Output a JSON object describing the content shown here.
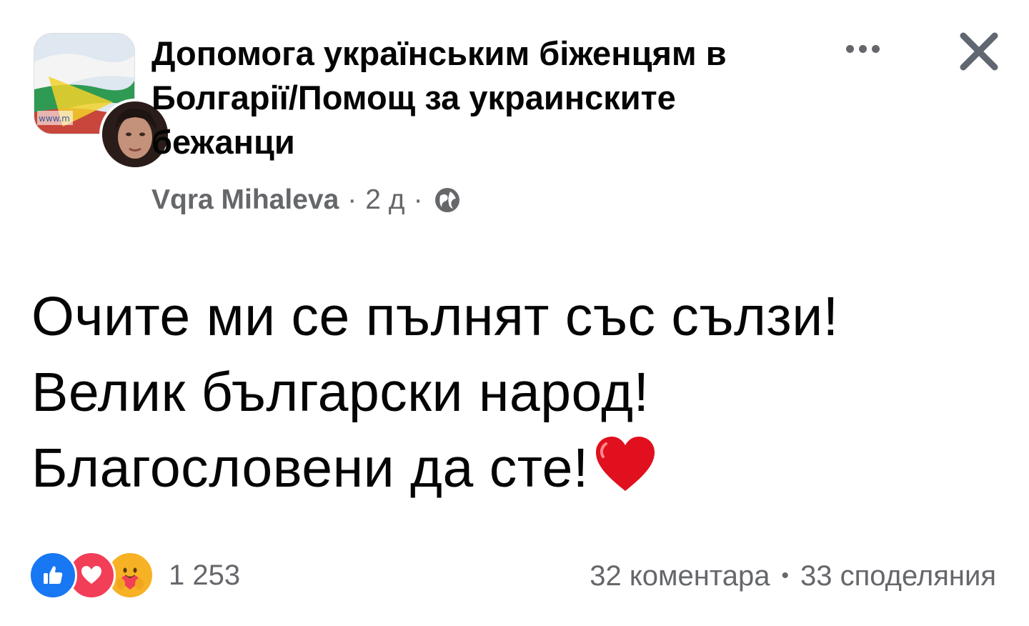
{
  "group": {
    "name": "Допомога українським біженцям в Болгарії/Помощ за украинските бежанци",
    "avatar_text": "www.m"
  },
  "post": {
    "author": "Vqra Mihaleva",
    "time": "2 д",
    "separator": "·",
    "privacy_icon": "globe-icon",
    "lines": [
      "Очите ми се пълнят със сълзи!",
      "Велик български народ!",
      "Благословени да сте!"
    ],
    "emoji": "heart-icon"
  },
  "header_actions": {
    "more_icon": "more-dots-icon",
    "close_icon": "close-icon"
  },
  "footer": {
    "reactions": [
      "like-icon",
      "love-icon",
      "care-icon"
    ],
    "reaction_count": "1 253",
    "comments": "32 коментара",
    "dot": "•",
    "shares": "33 споделяния"
  },
  "colors": {
    "text": "#050505",
    "secondary": "#65676b",
    "like": "#1877f2",
    "love": "#f33e58",
    "care": "#f7b125",
    "heart": "#e0101e"
  }
}
